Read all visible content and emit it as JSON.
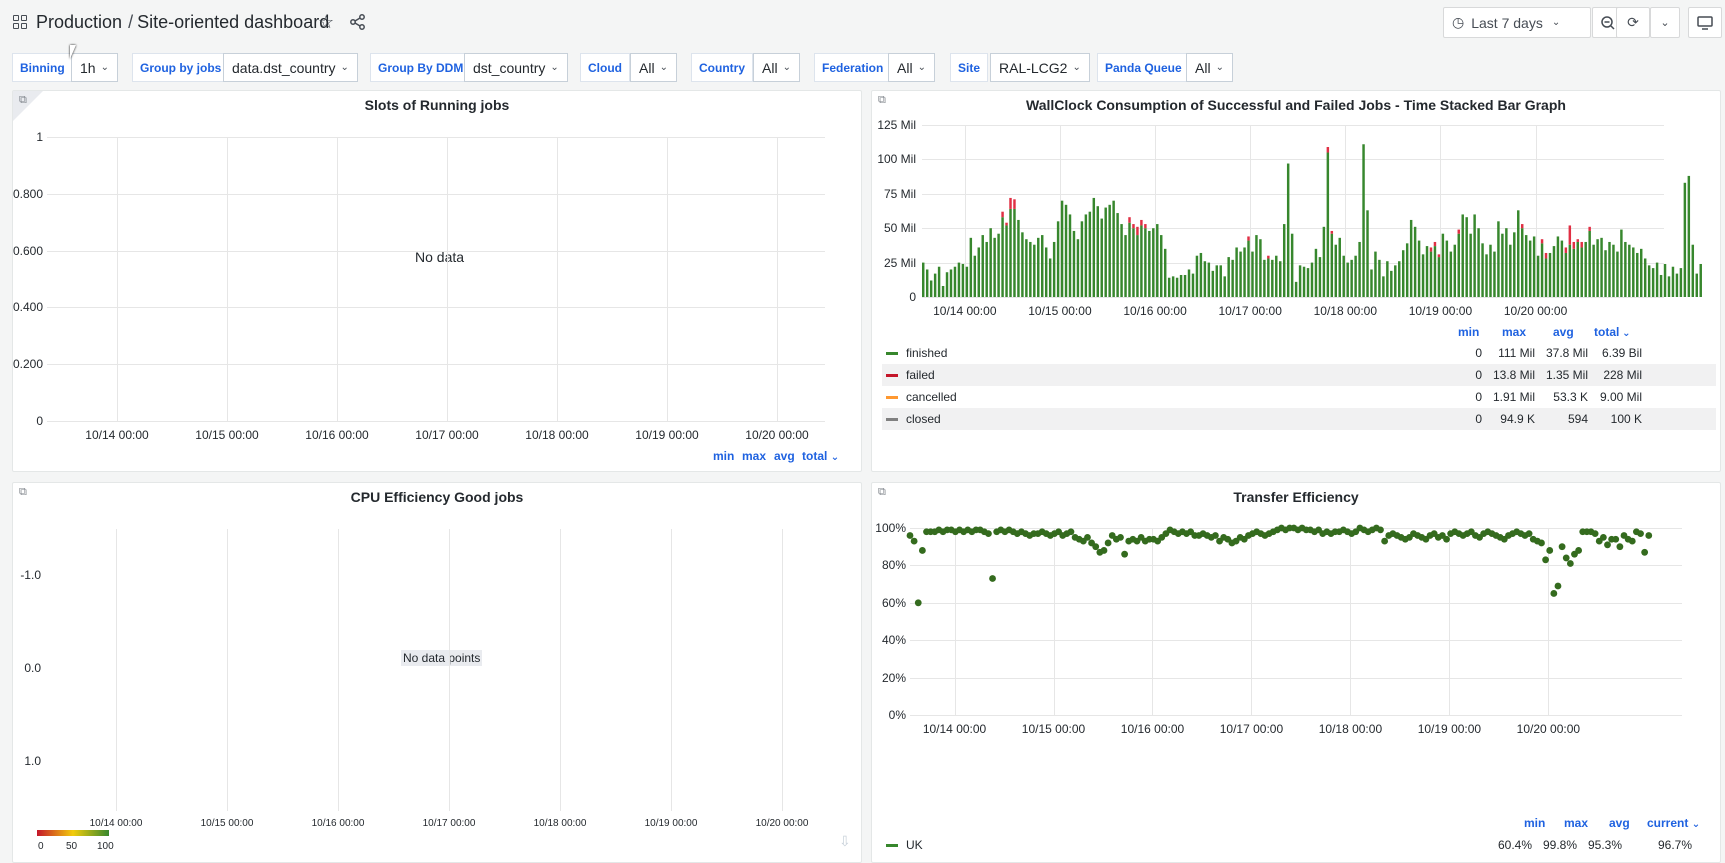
{
  "header": {
    "folder": "Production",
    "separator": "/",
    "title": "Site-oriented dashboard",
    "time_range": "Last 7 days"
  },
  "variables": [
    {
      "label": "Binning",
      "value": "1h"
    },
    {
      "label": "Group by jobs",
      "value": "data.dst_country"
    },
    {
      "label": "Group By DDM",
      "value": "dst_country"
    },
    {
      "label": "Cloud",
      "value": "All"
    },
    {
      "label": "Country",
      "value": "All"
    },
    {
      "label": "Federation",
      "value": "All"
    },
    {
      "label": "Site",
      "value": "RAL-LCG2"
    },
    {
      "label": "Panda Queue",
      "value": "All"
    }
  ],
  "x_dates": [
    "10/14 00:00",
    "10/15 00:00",
    "10/16 00:00",
    "10/17 00:00",
    "10/18 00:00",
    "10/19 00:00",
    "10/20 00:00"
  ],
  "panels": {
    "slots": {
      "title": "Slots of Running jobs",
      "no_data": "No data",
      "yticks": [
        "1",
        "0.800",
        "0.600",
        "0.400",
        "0.200",
        "0"
      ],
      "legend_headers": [
        "min",
        "max",
        "avg",
        "total"
      ]
    },
    "cpu": {
      "title": "CPU Efficiency Good jobs",
      "no_data": "No data points",
      "yticks": [
        "-1.0",
        "0.0",
        "1.0"
      ],
      "color_scale": [
        "0",
        "50",
        "100"
      ]
    },
    "transfer": {
      "title": "Transfer Efficiency",
      "legend_headers": [
        "min",
        "max",
        "avg",
        "current"
      ],
      "legend": [
        {
          "name": "UK",
          "color": "#37872d",
          "min": "60.4%",
          "max": "99.8%",
          "avg": "95.3%",
          "current": "96.7%"
        }
      ]
    }
  },
  "chart_data": [
    {
      "type": "bar",
      "title": "WallClock Consumption of Successful and Failed Jobs - Time Stacked Bar Graph",
      "ylim": [
        0,
        125
      ],
      "yticks": [
        "125 Mil",
        "100 Mil",
        "75 Mil",
        "50 Mil",
        "25 Mil",
        "0"
      ],
      "xticks": [
        "10/14 00:00",
        "10/15 00:00",
        "10/16 00:00",
        "10/17 00:00",
        "10/18 00:00",
        "10/19 00:00",
        "10/20 00:00"
      ],
      "x_start_days": -0.45,
      "x_step_days": 0.0417,
      "series": [
        {
          "name": "finished",
          "color": "#37872d",
          "values": [
            25,
            20,
            12,
            17,
            22,
            8,
            18,
            20,
            22,
            25,
            24,
            22,
            43,
            30,
            36,
            45,
            40,
            50,
            43,
            46,
            58,
            52,
            64,
            64,
            56,
            47,
            42,
            40,
            38,
            43,
            45,
            36,
            28,
            40,
            55,
            70,
            67,
            60,
            48,
            42,
            55,
            60,
            62,
            72,
            66,
            57,
            65,
            67,
            70,
            61,
            53,
            45,
            54,
            50,
            45,
            52,
            50,
            48,
            50,
            53,
            45,
            35,
            14,
            15,
            14,
            16,
            16,
            20,
            17,
            30,
            32,
            26,
            25,
            19,
            23,
            23,
            15,
            29,
            27,
            36,
            33,
            36,
            41,
            33,
            45,
            42,
            27,
            28,
            27,
            30,
            26,
            53,
            97,
            46,
            11,
            23,
            22,
            21,
            25,
            35,
            29,
            51,
            105,
            46,
            38,
            43,
            30,
            25,
            27,
            30,
            40,
            111,
            63,
            20,
            33,
            27,
            15,
            26,
            19,
            23,
            26,
            34,
            39,
            56,
            51,
            41,
            31,
            37,
            33,
            37,
            29,
            46,
            41,
            33,
            38,
            46,
            60,
            58,
            46,
            60,
            50,
            39,
            31,
            38,
            33,
            55,
            46,
            50,
            38,
            47,
            63,
            50,
            45,
            41,
            44,
            30,
            39,
            28,
            32,
            37,
            44,
            41,
            32,
            38,
            35,
            40,
            36,
            40,
            48,
            38,
            42,
            43,
            34,
            40,
            38,
            33,
            49,
            40,
            38,
            36,
            32,
            35,
            28,
            23,
            21,
            25,
            16,
            24,
            15,
            22,
            17,
            21,
            83,
            88,
            38,
            17,
            24
          ]
        },
        {
          "name": "failed",
          "color": "#e02f44",
          "values": [
            0,
            0,
            0,
            0,
            0,
            0,
            0,
            0,
            0,
            0,
            0,
            0,
            0,
            0,
            0,
            0,
            0,
            0,
            0,
            0,
            4,
            2,
            8,
            7,
            0,
            0,
            0,
            0,
            0,
            0,
            0,
            0,
            0,
            0,
            0,
            0,
            0,
            0,
            0,
            0,
            0,
            0,
            0,
            0,
            0,
            0,
            0,
            0,
            0,
            0,
            0,
            0,
            4,
            3,
            6,
            4,
            3,
            0,
            0,
            0,
            0,
            0,
            0,
            0,
            0,
            0,
            0,
            0,
            0,
            0,
            0,
            0,
            0,
            0,
            0,
            0,
            0,
            0,
            0,
            0,
            0,
            0,
            3,
            0,
            0,
            0,
            0,
            2,
            0,
            0,
            0,
            0,
            0,
            0,
            0,
            0,
            0,
            0,
            0,
            0,
            0,
            0,
            4,
            2,
            0,
            0,
            0,
            0,
            0,
            0,
            0,
            0,
            0,
            0,
            0,
            0,
            0,
            0,
            0,
            0,
            0,
            0,
            0,
            0,
            0,
            0,
            0,
            0,
            3,
            3,
            2,
            0,
            0,
            0,
            0,
            3,
            0,
            0,
            0,
            0,
            0,
            0,
            0,
            0,
            0,
            0,
            0,
            0,
            0,
            0,
            0,
            3,
            0,
            0,
            0,
            0,
            3,
            4,
            0,
            0,
            0,
            0,
            4,
            14,
            5,
            2,
            4,
            0,
            3,
            0,
            0,
            0,
            0,
            0,
            0,
            0,
            0,
            0,
            0,
            0,
            0,
            0,
            0,
            0,
            0,
            0,
            0,
            0,
            0,
            0,
            0,
            0,
            0
          ]
        },
        {
          "name": "cancelled",
          "color": "#ff9830",
          "values": []
        },
        {
          "name": "closed",
          "color": "#808080",
          "values": []
        }
      ],
      "legend_headers": [
        "min",
        "max",
        "avg",
        "total"
      ],
      "legend": [
        {
          "name": "finished",
          "color": "#37872d",
          "min": "0",
          "max": "111 Mil",
          "avg": "37.8 Mil",
          "total": "6.39 Bil"
        },
        {
          "name": "failed",
          "color": "#c4162a",
          "min": "0",
          "max": "13.8 Mil",
          "avg": "1.35 Mil",
          "total": "228 Mil"
        },
        {
          "name": "cancelled",
          "color": "#ff9830",
          "min": "0",
          "max": "1.91 Mil",
          "avg": "53.3 K",
          "total": "9.00 Mil"
        },
        {
          "name": "closed",
          "color": "#808080",
          "min": "0",
          "max": "94.9 K",
          "avg": "594",
          "total": "100 K"
        }
      ]
    },
    {
      "type": "scatter",
      "title": "Transfer Efficiency",
      "ylim": [
        0,
        100
      ],
      "yticks": [
        "100%",
        "80%",
        "60%",
        "40%",
        "20%",
        "0%"
      ],
      "xticks": [
        "10/14 00:00",
        "10/15 00:00",
        "10/16 00:00",
        "10/17 00:00",
        "10/18 00:00",
        "10/19 00:00",
        "10/20 00:00"
      ],
      "x_start_days": -0.45,
      "x_step_days": 0.0417,
      "series": [
        {
          "name": "UK",
          "color": "#37872d",
          "values": [
            96,
            93,
            60,
            88,
            98,
            98,
            98,
            99,
            98,
            99,
            99,
            98,
            99,
            98,
            99,
            98,
            99,
            99,
            98,
            97,
            73,
            98,
            99,
            98,
            99,
            98,
            97,
            98,
            97,
            96,
            97,
            97,
            98,
            97,
            96,
            97,
            98,
            96,
            97,
            98,
            95,
            94,
            93,
            95,
            92,
            90,
            87,
            88,
            92,
            96,
            94,
            95,
            86,
            93,
            94,
            93,
            95,
            93,
            94,
            94,
            93,
            95,
            97,
            99,
            98,
            97,
            98,
            97,
            98,
            96,
            96,
            97,
            96,
            95,
            96,
            93,
            95,
            94,
            92,
            93,
            95,
            94,
            96,
            97,
            98,
            97,
            96,
            97,
            98,
            99,
            100,
            99,
            100,
            100,
            99,
            100,
            99,
            99,
            98,
            99,
            97,
            98,
            97,
            98,
            98,
            99,
            98,
            97,
            98,
            100,
            99,
            98,
            99,
            100,
            99,
            93,
            96,
            97,
            96,
            95,
            94,
            95,
            97,
            96,
            95,
            94,
            96,
            97,
            95,
            96,
            94,
            97,
            98,
            97,
            96,
            97,
            98,
            96,
            95,
            97,
            98,
            97,
            96,
            95,
            94,
            96,
            97,
            98,
            97,
            96,
            97,
            94,
            93,
            92,
            83,
            88,
            65,
            69,
            90,
            84,
            81,
            86,
            88,
            98,
            98,
            98,
            97,
            93,
            95,
            91,
            94,
            94,
            90,
            96,
            94,
            93,
            98,
            97,
            87,
            96
          ]
        }
      ]
    }
  ]
}
